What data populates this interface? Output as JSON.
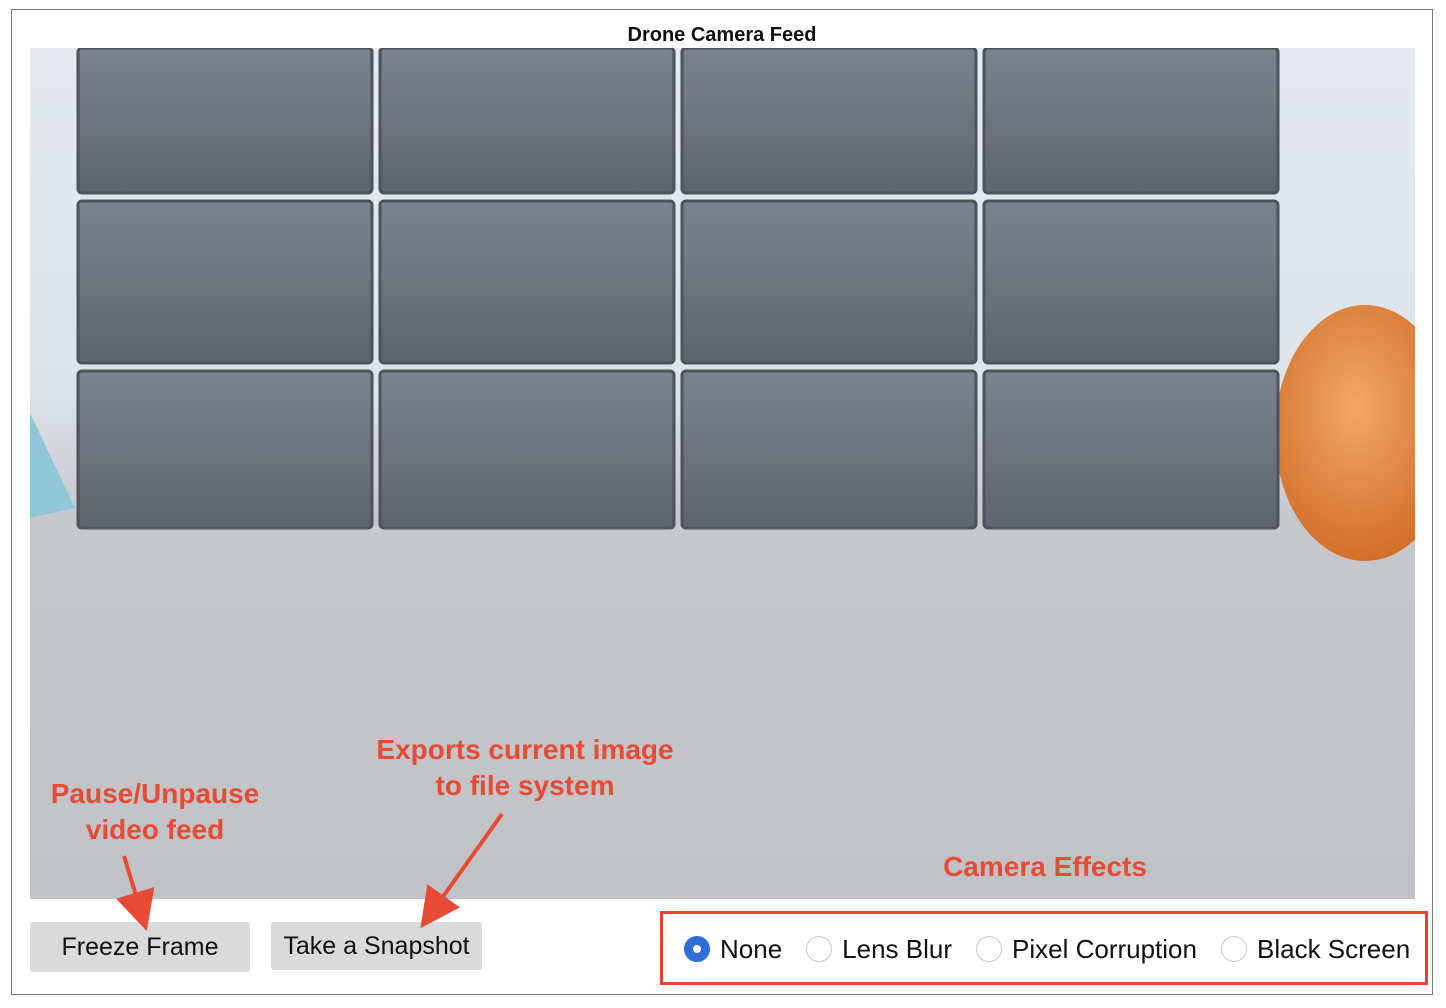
{
  "window": {
    "title": "Drone Camera Feed"
  },
  "buttons": {
    "freeze": "Freeze Frame",
    "snapshot": "Take a Snapshot"
  },
  "annotations": {
    "freeze_line1": "Pause/Unpause",
    "freeze_line2": "video feed",
    "snapshot_line1": "Exports current image",
    "snapshot_line2": "to file system",
    "effects": "Camera Effects"
  },
  "effects": {
    "options": [
      "None",
      "Lens Blur",
      "Pixel Corruption",
      "Black Screen"
    ],
    "selected": "None"
  },
  "colors": {
    "annotation": "#e84b35",
    "radio_selected": "#2f6ed8",
    "button_bg": "#dadada"
  }
}
